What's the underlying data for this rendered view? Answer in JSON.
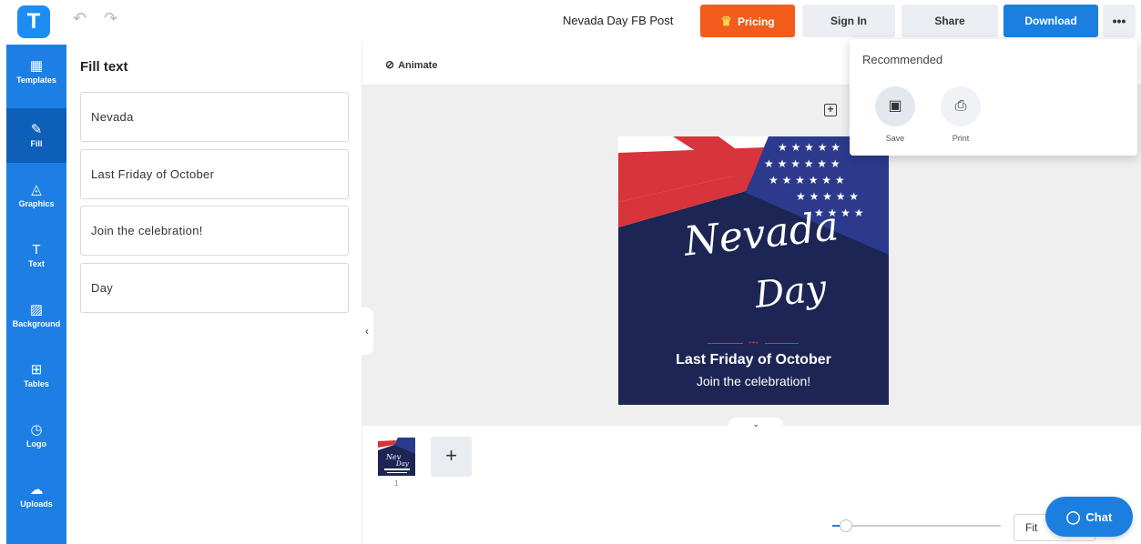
{
  "app": {
    "logo_letter": "T",
    "document_title": "Nevada Day FB Post"
  },
  "header": {
    "undo_icon": "↶",
    "redo_icon": "↷",
    "pricing_label": "Pricing",
    "signin_label": "Sign In",
    "share_label": "Share",
    "download_label": "Download",
    "more_label": "•••"
  },
  "sidebar": {
    "items": [
      {
        "label": "Templates",
        "icon": "▦"
      },
      {
        "label": "Fill",
        "icon": "✎"
      },
      {
        "label": "Graphics",
        "icon": "◬"
      },
      {
        "label": "Text",
        "icon": "T"
      },
      {
        "label": "Background",
        "icon": "▨"
      },
      {
        "label": "Tables",
        "icon": "⊞"
      },
      {
        "label": "Logo",
        "icon": "◷"
      },
      {
        "label": "Uploads",
        "icon": "☁"
      }
    ]
  },
  "fill_panel": {
    "title": "Fill text",
    "fields": [
      "Nevada",
      "Last Friday of October",
      "Join the celebration!",
      "Day"
    ]
  },
  "canvas": {
    "animate_label": "Animate",
    "poster": {
      "script_line1": "Nevada",
      "script_line2": "Day",
      "headline": "Last Friday of October",
      "subline": "Join the celebration!"
    },
    "page_number": "1"
  },
  "zoom": {
    "value": "Fit",
    "slider_fraction": 0.05
  },
  "chat": {
    "label": "Chat"
  },
  "download_menu": {
    "title": "Recommended",
    "options": [
      {
        "label": "Save",
        "icon": "💾"
      },
      {
        "label": "Print",
        "icon": "⎙"
      }
    ]
  },
  "colors": {
    "primary_blue": "#1d7fe3",
    "pricing_orange": "#f25c1c",
    "poster_navy": "#1c2553",
    "flag_red": "#d7343b"
  }
}
